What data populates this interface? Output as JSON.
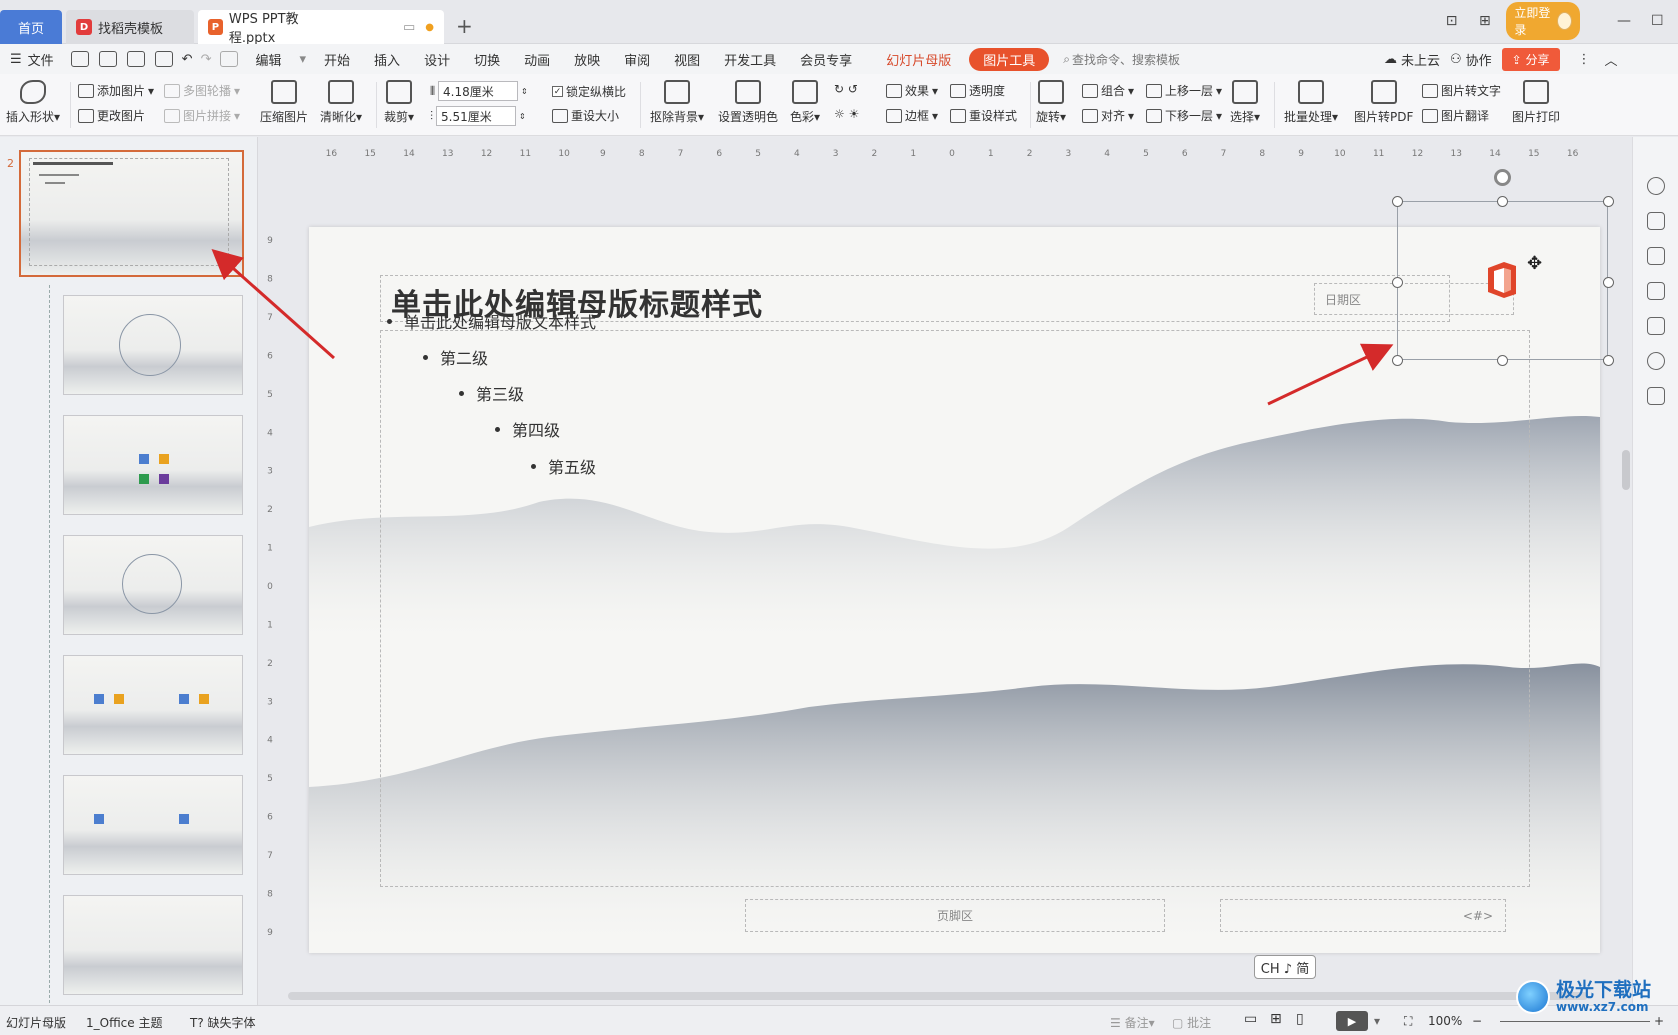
{
  "titlebar": {
    "tabs": [
      {
        "label": "首页"
      },
      {
        "label": "找稻壳模板"
      },
      {
        "label": "WPS PPT教程.pptx"
      }
    ],
    "login_label": "立即登录"
  },
  "menu": {
    "file": "文件",
    "edit": "编辑",
    "items": [
      "开始",
      "插入",
      "设计",
      "切换",
      "动画",
      "放映",
      "审阅",
      "视图",
      "开发工具",
      "会员专享"
    ],
    "slide_master": "幻灯片母版",
    "picture_tools": "图片工具",
    "search_placeholder": "查找命令、搜索模板",
    "cloud": "未上云",
    "collab": "协作",
    "share": "分享"
  },
  "ribbon": {
    "insert_shape": "插入形状",
    "add_picture": "添加图片",
    "change_picture": "更改图片",
    "multi_carousel": "多图轮播",
    "picture_collage": "图片拼接",
    "compress": "压缩图片",
    "sharpen": "清晰化",
    "crop": "裁剪",
    "width_value": "4.18厘米",
    "height_value": "5.51厘米",
    "lock_ratio": "锁定纵横比",
    "reset_size": "重设大小",
    "remove_bg": "抠除背景",
    "set_transparent": "设置透明色",
    "color": "色彩",
    "effects": "效果",
    "border": "边框",
    "transparency": "透明度",
    "reset_style": "重设样式",
    "rotate": "旋转",
    "group": "组合",
    "align": "对齐",
    "bring_forward": "上移一层",
    "send_backward": "下移一层",
    "select": "选择",
    "batch": "批量处理",
    "to_pdf": "图片转PDF",
    "to_text": "图片转文字",
    "translate": "图片翻译",
    "print": "图片打印"
  },
  "slide_panel": {
    "master_number": "2"
  },
  "ruler": {
    "h_ticks": [
      "16",
      "15",
      "14",
      "13",
      "12",
      "11",
      "10",
      "9",
      "8",
      "7",
      "6",
      "5",
      "4",
      "3",
      "2",
      "1",
      "0",
      "1",
      "2",
      "3",
      "4",
      "5",
      "6",
      "7",
      "8",
      "9",
      "10",
      "11",
      "12",
      "13",
      "14",
      "15",
      "16"
    ],
    "v_ticks": [
      "9",
      "8",
      "7",
      "6",
      "5",
      "4",
      "3",
      "2",
      "1",
      "0",
      "1",
      "2",
      "3",
      "4",
      "5",
      "6",
      "7",
      "8",
      "9"
    ]
  },
  "slide": {
    "title": "单击此处编辑母版标题样式",
    "bullets": [
      "单击此处编辑母版文本样式",
      "第二级",
      "第三级",
      "第四级",
      "第五级"
    ],
    "date": "日期区",
    "footer": "页脚区",
    "number": "<#>"
  },
  "ime": "CH ♪ 简",
  "status": {
    "mode": "幻灯片母版",
    "theme": "1_Office 主题",
    "missing_font": "缺失字体",
    "notes": "备注",
    "comments": "批注",
    "zoom": "100%"
  },
  "watermark": {
    "name": "极光下载站",
    "url": "www.xz7.com"
  },
  "colors": {
    "accent": "#e8522c",
    "home_tab": "#4a7bd6",
    "arrow": "#d42a2a"
  }
}
